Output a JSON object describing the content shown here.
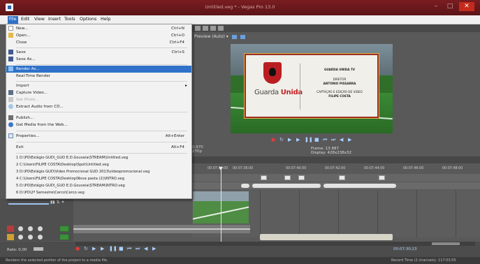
{
  "window": {
    "title": "Untitled.veg * - Vegas Pro 13.0",
    "min_icon": "minimize-icon",
    "max_icon": "maximize-icon",
    "close_icon": "close-icon"
  },
  "menubar": {
    "items": [
      "File",
      "Edit",
      "View",
      "Insert",
      "Tools",
      "Options",
      "Help"
    ],
    "active": "File"
  },
  "file_menu": {
    "items": [
      {
        "label": "New...",
        "shortcut": "Ctrl+N",
        "icon": "new-file-icon",
        "enabled": true
      },
      {
        "label": "Open...",
        "shortcut": "Ctrl+O",
        "icon": "open-folder-icon",
        "enabled": true
      },
      {
        "label": "Close",
        "shortcut": "Ctrl+F4",
        "icon": "",
        "enabled": true
      },
      {
        "label": "Save",
        "shortcut": "Ctrl+S",
        "icon": "save-icon",
        "enabled": true
      },
      {
        "label": "Save As...",
        "shortcut": "",
        "icon": "save-as-icon",
        "enabled": true
      },
      {
        "label": "Render As...",
        "shortcut": "",
        "icon": "render-icon",
        "enabled": true,
        "highlighted": true
      },
      {
        "label": "Real-Time Render",
        "shortcut": "",
        "icon": "",
        "enabled": true
      },
      {
        "label": "Import",
        "shortcut": "",
        "icon": "",
        "enabled": true,
        "submenu": true
      },
      {
        "label": "Capture Video...",
        "shortcut": "",
        "icon": "capture-video-icon",
        "enabled": true
      },
      {
        "label": "Get Photo...",
        "shortcut": "",
        "icon": "camera-icon",
        "enabled": false
      },
      {
        "label": "Extract Audio from CD...",
        "shortcut": "",
        "icon": "cd-icon",
        "enabled": true
      },
      {
        "label": "Publish...",
        "shortcut": "",
        "icon": "publish-icon",
        "enabled": true
      },
      {
        "label": "Get Media from the Web...",
        "shortcut": "",
        "icon": "web-media-icon",
        "enabled": true
      },
      {
        "label": "Properties...",
        "shortcut": "Alt+Enter",
        "icon": "properties-icon",
        "enabled": true
      },
      {
        "label": "Exit",
        "shortcut": "Alt+F4",
        "icon": "",
        "enabled": true
      }
    ],
    "recent_files": [
      "1 D:\\PO\\Estágio GUD\\_GUD E.D.Gouveia\\STREAM\\Untitled.veg",
      "2 C:\\Users\\FILIPE COSTA\\Desktop\\Spot\\Untitled.veg",
      "3 D:\\PO\\Estágio GUD\\Video Promocional GUD 2013\\videopromocional.veg",
      "4 C:\\Users\\FILIPE COSTA\\Desktop\\Nova pasta (2)\\INTRO.veg",
      "5 D:\\PO\\Estágio GUD\\_GUD E.D.Gouveia\\STREAM\\INTRO.veg",
      "6 D:\\PO\\2º Semestre\\Cerco\\Cerco.veg"
    ]
  },
  "preview": {
    "label": "Preview (Auto)",
    "frame_label": "Frame:",
    "frame_value": "13 887",
    "display_label": "Display:",
    "display_value": "428x238x32",
    "left_info_1": "0,970",
    "left_info_2": "270p"
  },
  "video_card": {
    "brand_left": "Guarda",
    "brand_right": "Unida",
    "line1": "GUARDA UNIDA TV",
    "line2": "DIRETOR",
    "line3": "ANTÓNIO PISSARRA",
    "line4": "CAPTAÇÃO E EDIÇÃO DE VIDEO",
    "line5": "FILIPE COSTA"
  },
  "ruler": [
    "00:07:35:00",
    "00:07:36:00",
    "00:07:40:00",
    "00:07:42:00",
    "00:07:44:00",
    "00:07:46:00",
    "00:07:48:00"
  ],
  "rate": {
    "label": "Rate: 0,00"
  },
  "timecode": "00:07:30;23",
  "status": {
    "left": "Renders the selected portion of the project to a media file.",
    "right": "Record Time (2 channels): 117:03:05"
  }
}
